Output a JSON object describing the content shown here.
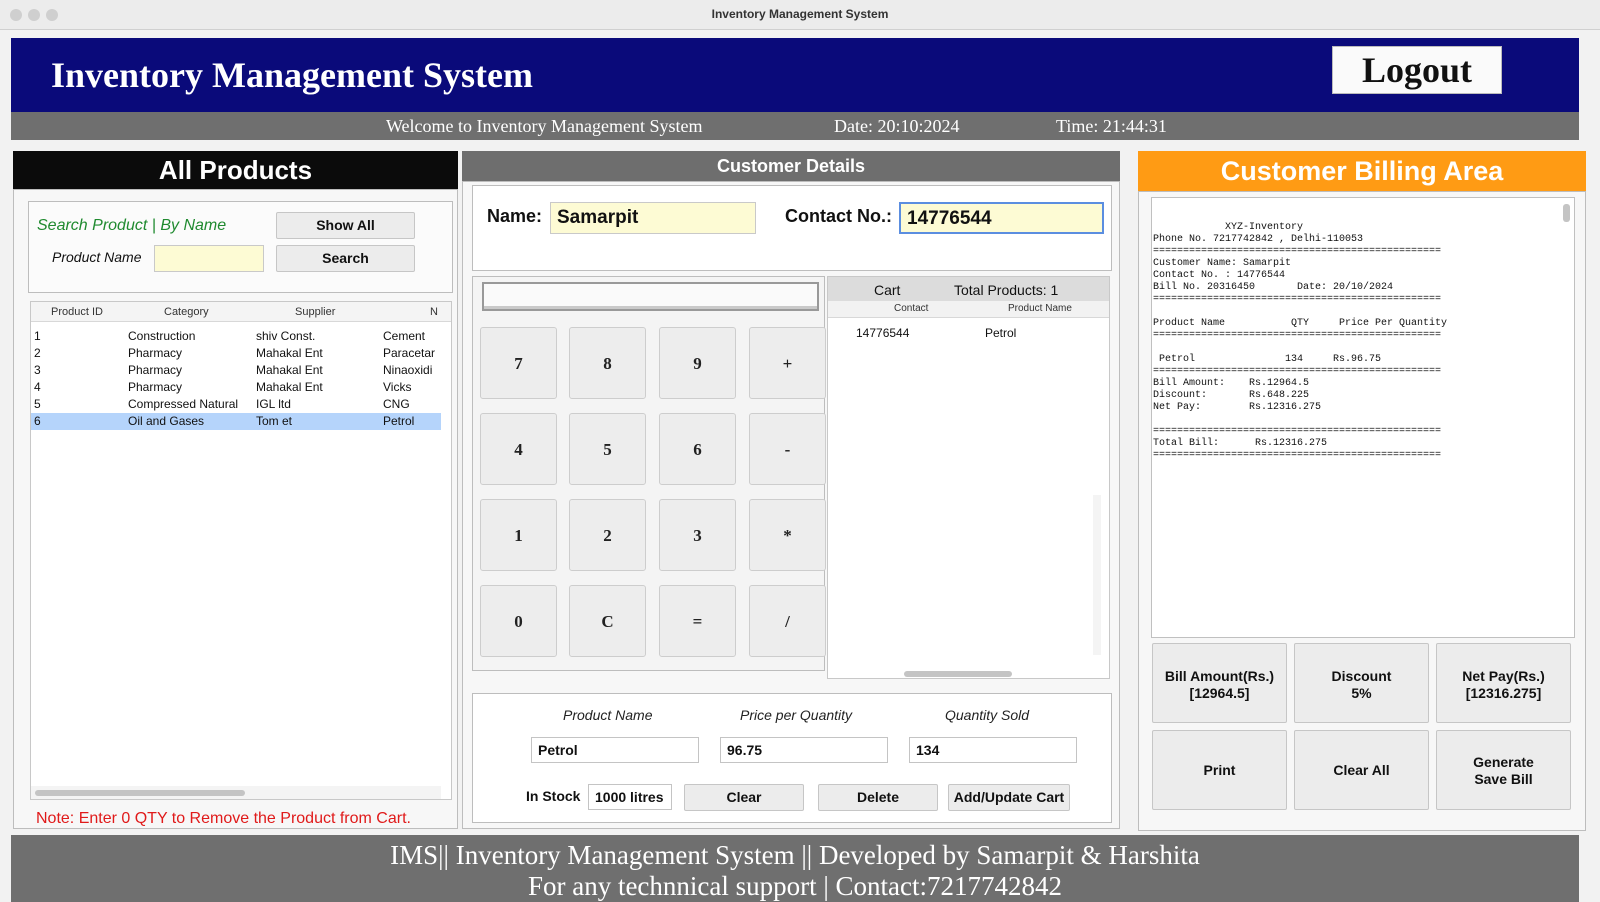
{
  "window": {
    "title": "Inventory Management System"
  },
  "header": {
    "title": "Inventory Management System",
    "logout_label": "Logout",
    "welcome": "Welcome to Inventory Management System",
    "date": "Date: 20:10:2024",
    "time": "Time: 21:44:31"
  },
  "products": {
    "heading": "All Products",
    "search_label": "Search Product | By Name",
    "show_all_label": "Show All",
    "product_name_label": "Product Name",
    "product_name_value": "",
    "search_label_btn": "Search",
    "columns": [
      "Product ID",
      "Category",
      "Supplier",
      "N"
    ],
    "rows": [
      [
        "1",
        "Construction",
        "shiv Const.",
        "Cement"
      ],
      [
        "2",
        "Pharmacy",
        "Mahakal Ent",
        "Paracetar"
      ],
      [
        "3",
        "Pharmacy",
        "Mahakal Ent",
        "Ninaoxidi"
      ],
      [
        "4",
        "Pharmacy",
        "Mahakal Ent",
        "Vicks"
      ],
      [
        "5",
        "Compressed Natural",
        "IGL ltd",
        "CNG"
      ],
      [
        "6",
        "Oil and Gases",
        "Tom et",
        "Petrol"
      ]
    ],
    "selected_row": 5,
    "note": "Note: Enter 0 QTY to Remove the Product from Cart."
  },
  "customer": {
    "heading": "Customer Details",
    "name_label": "Name:",
    "name_value": "Samarpit",
    "contact_label": "Contact No.:",
    "contact_value": "14776544"
  },
  "calculator": {
    "display": "",
    "keys": [
      "7",
      "8",
      "9",
      "+",
      "4",
      "5",
      "6",
      "-",
      "1",
      "2",
      "3",
      "*",
      "0",
      "C",
      "=",
      "/"
    ]
  },
  "cart": {
    "title": "Cart",
    "total": "Total Products: 1",
    "col_contact": "Contact",
    "col_product": "Product Name",
    "rows": [
      [
        "14776544",
        "Petrol"
      ]
    ]
  },
  "cart_form": {
    "product_name_label": "Product Name",
    "price_label": "Price per Quantity",
    "qty_label": "Quantity Sold",
    "product_name_value": "Petrol",
    "price_value": "96.75",
    "qty_value": "134",
    "in_stock_label": "In Stock",
    "in_stock_value": "1000 litres",
    "clear_label": "Clear",
    "delete_label": "Delete",
    "add_label": "Add/Update Cart"
  },
  "billing": {
    "heading": "Customer Billing Area",
    "bill_lines": [
      "            XYZ-Inventory",
      "Phone No. 7217742842 , Delhi-110053",
      "================================================",
      "Customer Name: Samarpit",
      "Contact No. : 14776544",
      "Bill No. 20316450       Date: 20/10/2024",
      "================================================",
      "",
      "Product Name           QTY     Price Per Quantity",
      "================================================",
      "",
      " Petrol               134     Rs.96.75",
      "================================================",
      "Bill Amount:    Rs.12964.5",
      "Discount:       Rs.648.225",
      "Net Pay:        Rs.12316.275",
      "",
      "================================================",
      "Total Bill:      Rs.12316.275",
      "================================================"
    ],
    "bill_amount_label": "Bill Amount(Rs.)",
    "bill_amount_value": "[12964.5]",
    "discount_label": "Discount",
    "discount_value": "5%",
    "net_pay_label": "Net Pay(Rs.)",
    "net_pay_value": "[12316.275]",
    "print_label": "Print",
    "clear_all_label": "Clear All",
    "generate_line1": "Generate",
    "generate_line2": "Save Bill"
  },
  "footer": {
    "line1": "IMS|| Inventory Management System || Developed  by  Samarpit & Harshita",
    "line2": "For any technnical support  | Contact:7217742842"
  }
}
